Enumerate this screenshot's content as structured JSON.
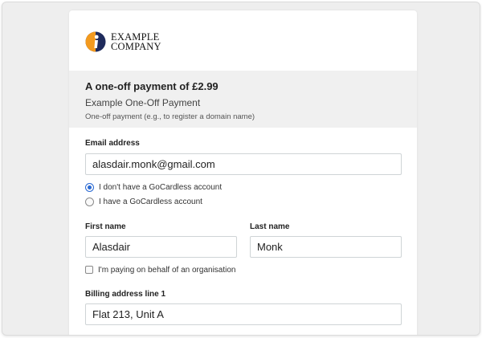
{
  "company": {
    "logo_line1": "EXAMPLE",
    "logo_line2": "COMPANY"
  },
  "summary": {
    "amount": "A one-off payment of £2.99",
    "title": "Example One-Off Payment",
    "subtitle": "One-off payment (e.g., to register a domain name)"
  },
  "form": {
    "email_label": "Email address",
    "email_value": "alasdair.monk@gmail.com",
    "account_options": [
      {
        "label": "I don't have a GoCardless account",
        "selected": true
      },
      {
        "label": "I have a GoCardless account",
        "selected": false
      }
    ],
    "first_name_label": "First name",
    "first_name_value": "Alasdair",
    "last_name_label": "Last name",
    "last_name_value": "Monk",
    "organisation_label": "I'm paying on behalf of an organisation",
    "organisation_checked": false,
    "billing1_label": "Billing address line 1",
    "billing1_value": "Flat 213, Unit A"
  },
  "colors": {
    "accent": "#2a6ad4",
    "logo_orange": "#f39a1e",
    "logo_navy": "#1f2b5c"
  }
}
